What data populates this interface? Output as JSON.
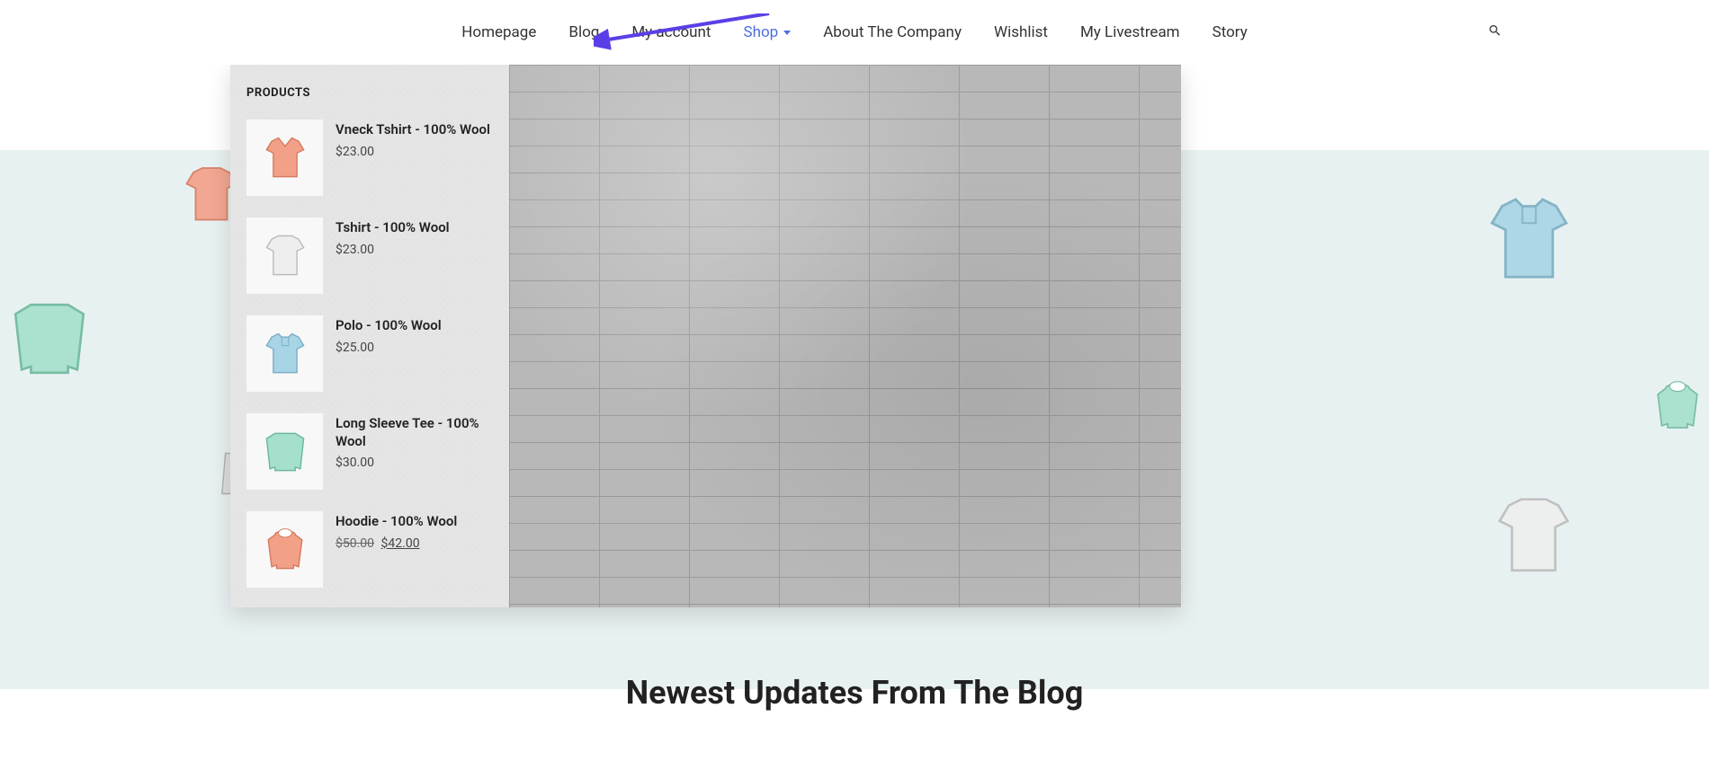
{
  "nav": {
    "items": [
      {
        "label": "Homepage",
        "active": false,
        "hasSubmenu": false
      },
      {
        "label": "Blog",
        "active": false,
        "hasSubmenu": false
      },
      {
        "label": "My account",
        "active": false,
        "hasSubmenu": false
      },
      {
        "label": "Shop",
        "active": true,
        "hasSubmenu": true
      },
      {
        "label": "About The Company",
        "active": false,
        "hasSubmenu": false
      },
      {
        "label": "Wishlist",
        "active": false,
        "hasSubmenu": false
      },
      {
        "label": "My Livestream",
        "active": false,
        "hasSubmenu": false
      },
      {
        "label": "Story",
        "active": false,
        "hasSubmenu": false
      }
    ]
  },
  "megaMenu": {
    "heading": "PRODUCTS",
    "products": [
      {
        "name": "Vneck Tshirt - 100% Wool",
        "price": "$23.00",
        "oldPrice": null,
        "thumbColor": "#f2a088",
        "type": "vneck"
      },
      {
        "name": "Tshirt - 100% Wool",
        "price": "$23.00",
        "oldPrice": null,
        "thumbColor": "#e8e8e8",
        "type": "tshirt"
      },
      {
        "name": "Polo - 100% Wool",
        "price": "$25.00",
        "oldPrice": null,
        "thumbColor": "#a7d5e6",
        "type": "polo"
      },
      {
        "name": "Long Sleeve Tee - 100% Wool",
        "price": "$30.00",
        "oldPrice": null,
        "thumbColor": "#a5e0cc",
        "type": "longsleeve"
      },
      {
        "name": "Hoodie - 100% Wool",
        "price": "$42.00",
        "oldPrice": "$50.00",
        "thumbColor": "#f2a088",
        "type": "hoodie"
      }
    ]
  },
  "blogSection": {
    "heading": "Newest Updates From The Blog"
  },
  "colors": {
    "accent": "#4a6ee0",
    "arrowColor": "#5b3fe6"
  }
}
